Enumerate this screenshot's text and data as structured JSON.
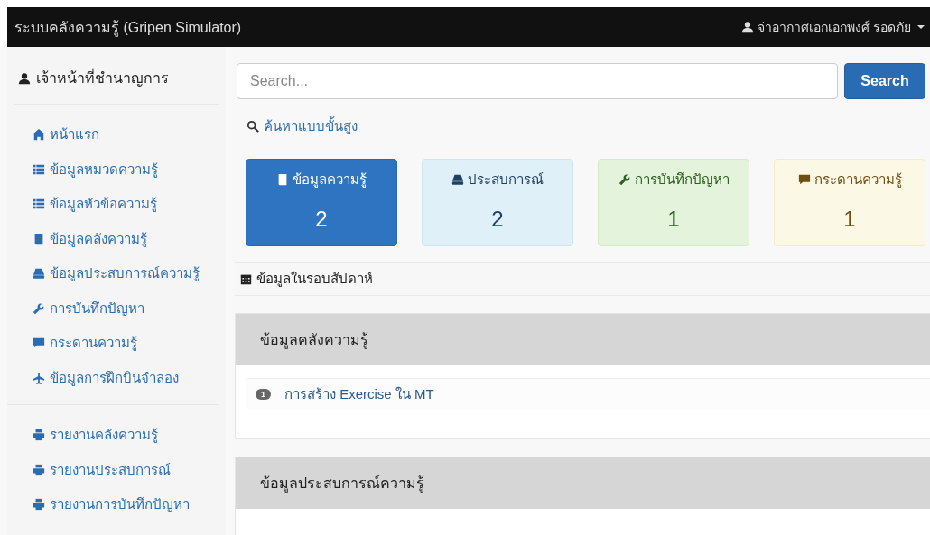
{
  "navbar": {
    "brand": "ระบบคลังความรู้ (Gripen Simulator)",
    "user": "จ่าอากาศเอกเอกพงศ์ รอดภัย"
  },
  "sidebar": {
    "title": "เจ้าหน้าที่ชำนาญการ",
    "groups": [
      {
        "items": [
          "หน้าแรก",
          "ข้อมูลหมวดความรู้",
          "ข้อมูลหัวข้อความรู้",
          "ข้อมูลคลังความรู้",
          "ข้อมูลประสบการณ์ความรู้",
          "การบันทึกปัญหา",
          "กระดานความรู้",
          "ข้อมูลการฝึกบินจำลอง"
        ]
      },
      {
        "items": [
          "รายงานคลังความรู้",
          "รายงานประสบการณ์",
          "รายงานการบันทึกปัญหา"
        ]
      }
    ]
  },
  "search": {
    "placeholder": "Search...",
    "button": "Search",
    "advanced": "ค้นหาแบบขั้นสูง"
  },
  "stats": [
    {
      "label": "ข้อมูลความรู้",
      "count": "2"
    },
    {
      "label": "ประสบการณ์",
      "count": "2"
    },
    {
      "label": "การบันทึกปัญหา",
      "count": "1"
    },
    {
      "label": "กระดานความรู้",
      "count": "1"
    }
  ],
  "weekly": {
    "title": "ข้อมูลในรอบสัปดาห์"
  },
  "panels": [
    {
      "title": "ข้อมูลคลังความรู้",
      "items": [
        {
          "badge": "1",
          "text": "การสร้าง Exercise ใน MT"
        }
      ]
    },
    {
      "title": "ข้อมูลประสบการณ์ความรู้"
    }
  ]
}
